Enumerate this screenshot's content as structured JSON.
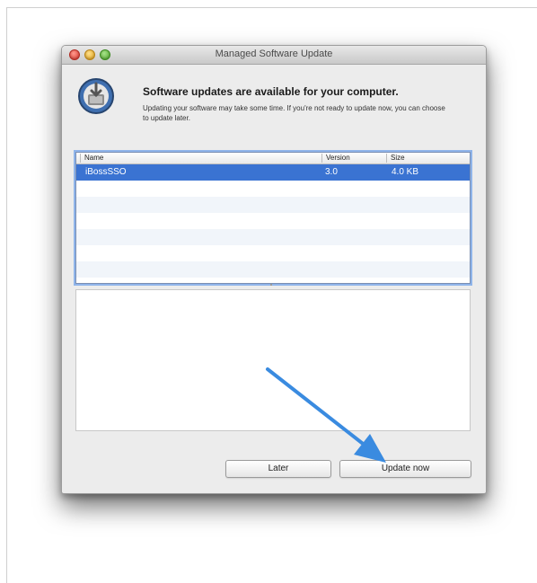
{
  "window": {
    "title": "Managed Software Update"
  },
  "header": {
    "icon": "software-update-icon",
    "headline": "Software updates are available for your computer.",
    "description": "Updating your software may take some time. If you're not ready to update now, you can choose to update later."
  },
  "table": {
    "columns": [
      "Name",
      "Version",
      "Size"
    ],
    "rows": [
      {
        "name": "iBossSSO",
        "version": "3.0",
        "size": "4.0 KB",
        "selected": true
      }
    ]
  },
  "buttons": {
    "later": "Later",
    "update_now": "Update now"
  },
  "colors": {
    "selection": "#3a73d2",
    "arrow": "#3a8be0"
  }
}
